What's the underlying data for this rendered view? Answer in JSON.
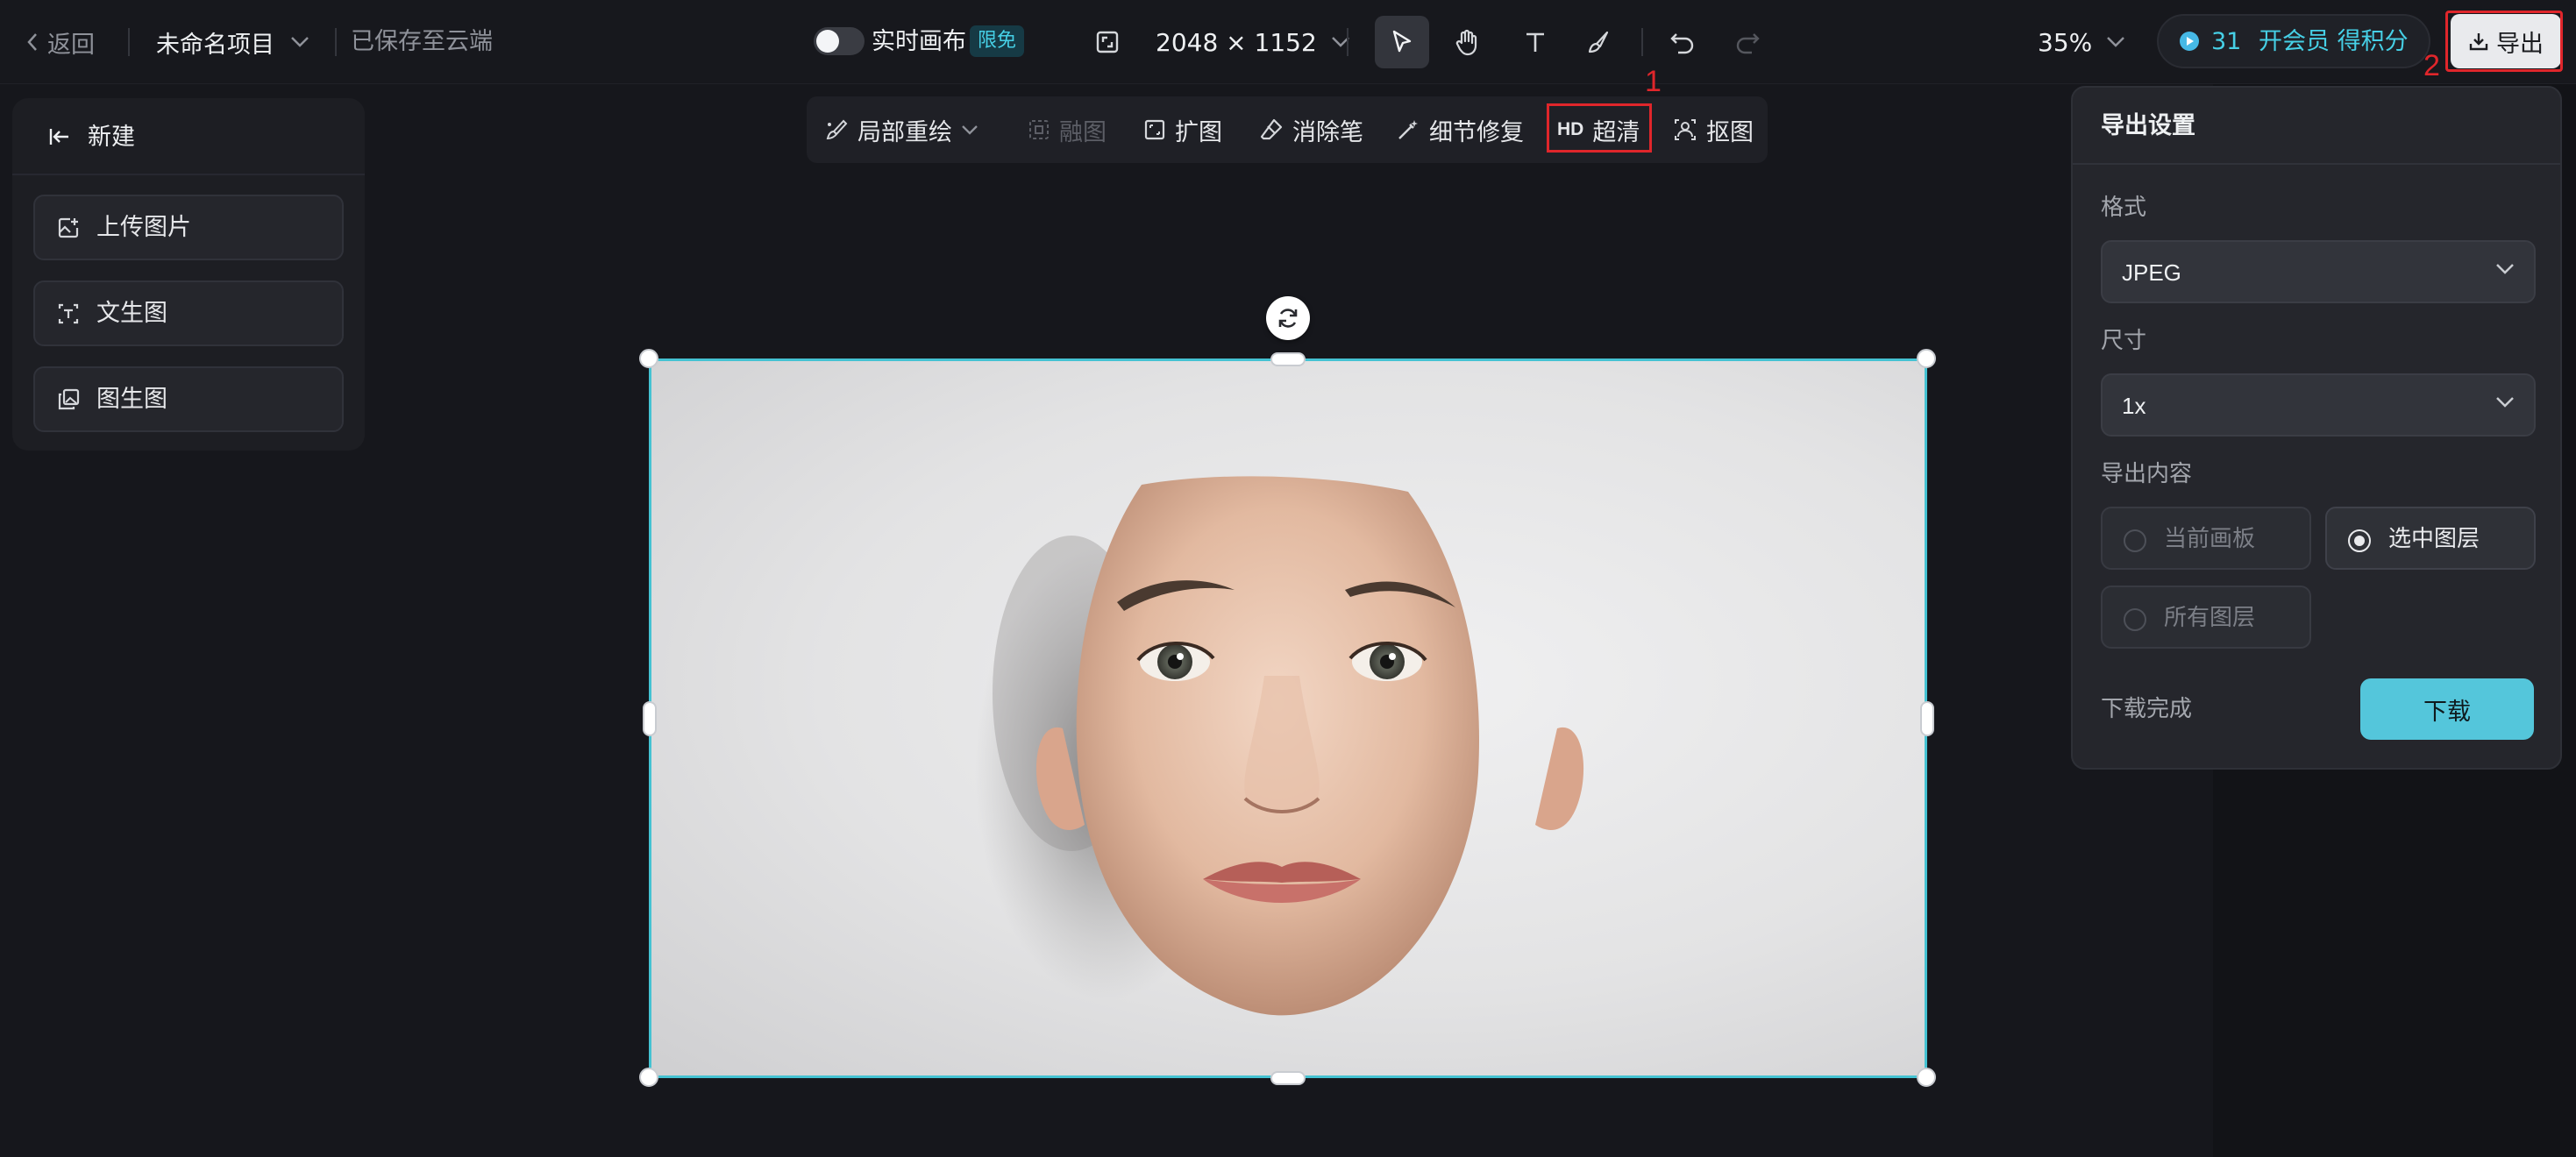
{
  "topbar": {
    "back_label": "返回",
    "project_name": "未命名项目",
    "save_status": "已保存至云端",
    "realtime_label": "实时画布",
    "free_badge": "限免",
    "canvas_size": "2048 × 1152",
    "zoom": "35%",
    "points": "31",
    "vip_label": "开会员 得积分",
    "export_label": "导出"
  },
  "annotations": {
    "marker_1": "1",
    "marker_2": "2",
    "color": "#e0262b"
  },
  "left_panel": {
    "new_label": "新建",
    "items": [
      {
        "label": "上传图片",
        "icon": "upload-image-icon"
      },
      {
        "label": "文生图",
        "icon": "text-to-image-icon"
      },
      {
        "label": "图生图",
        "icon": "image-to-image-icon"
      }
    ]
  },
  "edit_toolbar": {
    "inpaint": "局部重绘",
    "blend": "融图",
    "expand": "扩图",
    "eraser": "消除笔",
    "detail_fix": "细节修复",
    "hd_tag": "HD",
    "upscale": "超清",
    "cutout": "抠图"
  },
  "export_panel": {
    "title": "导出设置",
    "format_label": "格式",
    "format_value": "JPEG",
    "size_label": "尺寸",
    "size_value": "1x",
    "content_label": "导出内容",
    "options": [
      {
        "label": "当前画板",
        "selected": false
      },
      {
        "label": "选中图层",
        "selected": true
      },
      {
        "label": "所有图层",
        "selected": false
      }
    ],
    "status": "下载完成",
    "download_label": "下载"
  },
  "colors": {
    "accent": "#46d0e6",
    "selection": "#44c2d2",
    "download_button": "#54c6db",
    "background": "#16171c"
  }
}
